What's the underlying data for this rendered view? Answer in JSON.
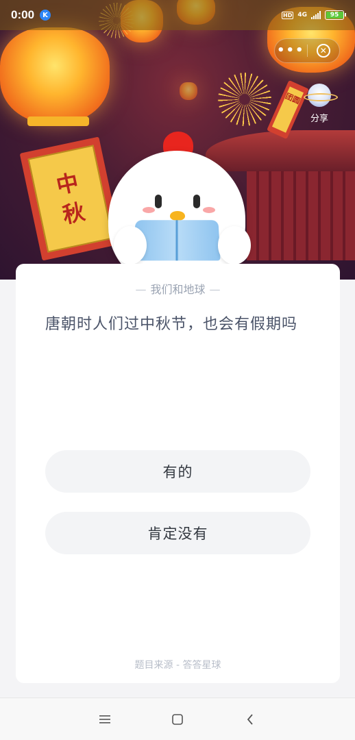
{
  "status_bar": {
    "time": "0:00",
    "app_badge": "K",
    "hd": "HD",
    "network": "4G",
    "battery": "95",
    "battery_level": 0.95
  },
  "capsule": {
    "more_icon": "more-dots-icon",
    "close_icon": "close-circle-icon"
  },
  "hero": {
    "banner_text_line1": "中",
    "banner_text_line2": "秋",
    "small_banner_text": "团圆",
    "share_label": "分享"
  },
  "quiz": {
    "category": "我们和地球",
    "question": "唐朝时人们过中秋节，也会有假期吗",
    "options": [
      {
        "label": "有的"
      },
      {
        "label": "肯定没有"
      }
    ],
    "source": "题目来源 - 答答星球"
  },
  "nav_bar": {
    "menu_icon": "menu-icon",
    "home_icon": "home-square-icon",
    "back_icon": "back-chevron-icon"
  },
  "colors": {
    "hero_bg": "#4a1d34",
    "card_bg": "#ffffff",
    "option_bg": "#f3f4f6",
    "question_text": "#4a5368",
    "muted_text": "#9aa3b2"
  }
}
